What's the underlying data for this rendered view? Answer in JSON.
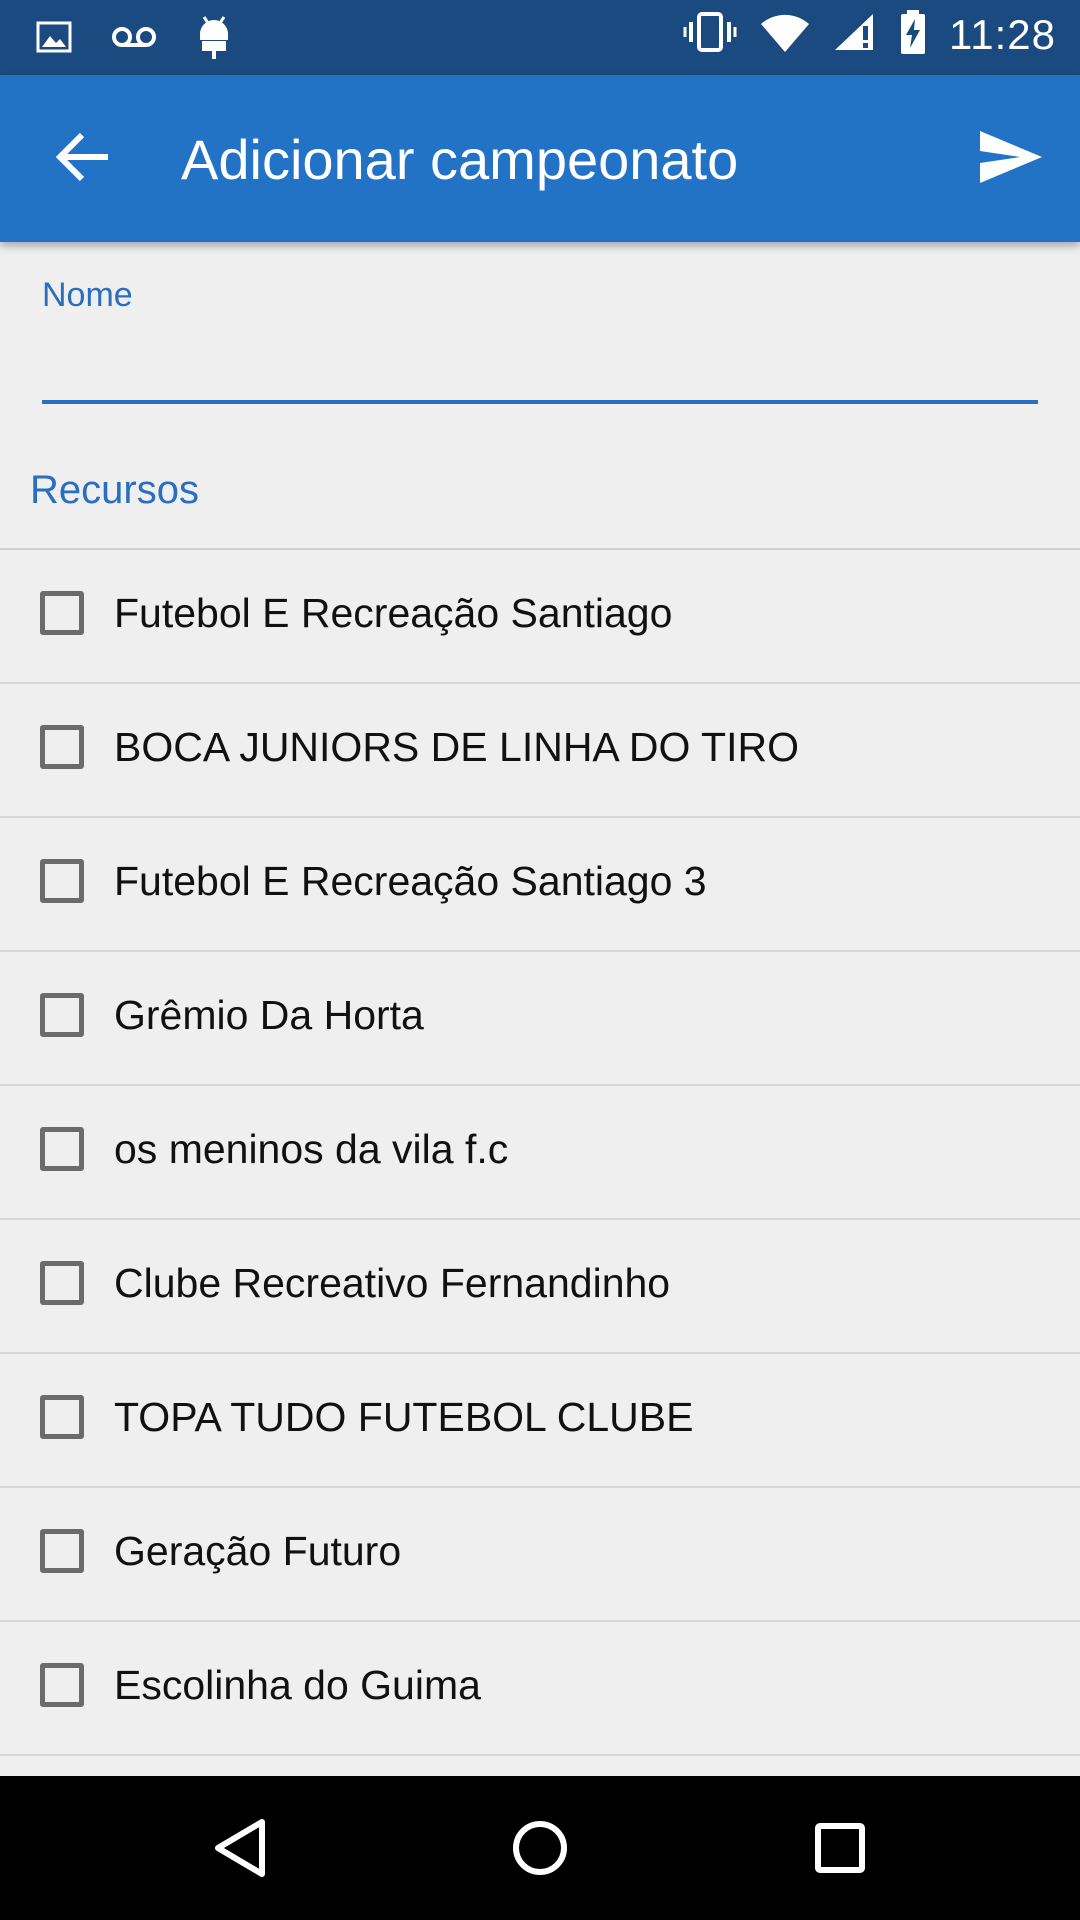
{
  "status_bar": {
    "time": "11:28",
    "left_icons": [
      "image-icon",
      "voicemail-icon",
      "android-icon"
    ],
    "right_icons": [
      "vibrate-icon",
      "wifi-icon",
      "signal-icon",
      "battery-charging-icon"
    ]
  },
  "app_bar": {
    "title": "Adicionar campeonato",
    "back_icon": "arrow-back-icon",
    "action_icon": "send-icon",
    "color": "#2272c6"
  },
  "form": {
    "name_label": "Nome",
    "name_value": "",
    "section_title": "Recursos"
  },
  "resources": [
    {
      "label": "Futebol E Recreação Santiago",
      "checked": false
    },
    {
      "label": "BOCA JUNIORS DE LINHA DO TIRO",
      "checked": false
    },
    {
      "label": "Futebol E Recreação Santiago 3",
      "checked": false
    },
    {
      "label": "Grêmio Da Horta",
      "checked": false
    },
    {
      "label": "os meninos da vila f.c",
      "checked": false
    },
    {
      "label": "Clube Recreativo Fernandinho",
      "checked": false
    },
    {
      "label": "TOPA TUDO FUTEBOL CLUBE",
      "checked": false
    },
    {
      "label": "Geração Futuro",
      "checked": false
    },
    {
      "label": "Escolinha do Guima",
      "checked": false
    }
  ],
  "nav_bar": {
    "buttons": [
      "back-triangle-icon",
      "home-circle-icon",
      "recents-square-icon"
    ]
  }
}
